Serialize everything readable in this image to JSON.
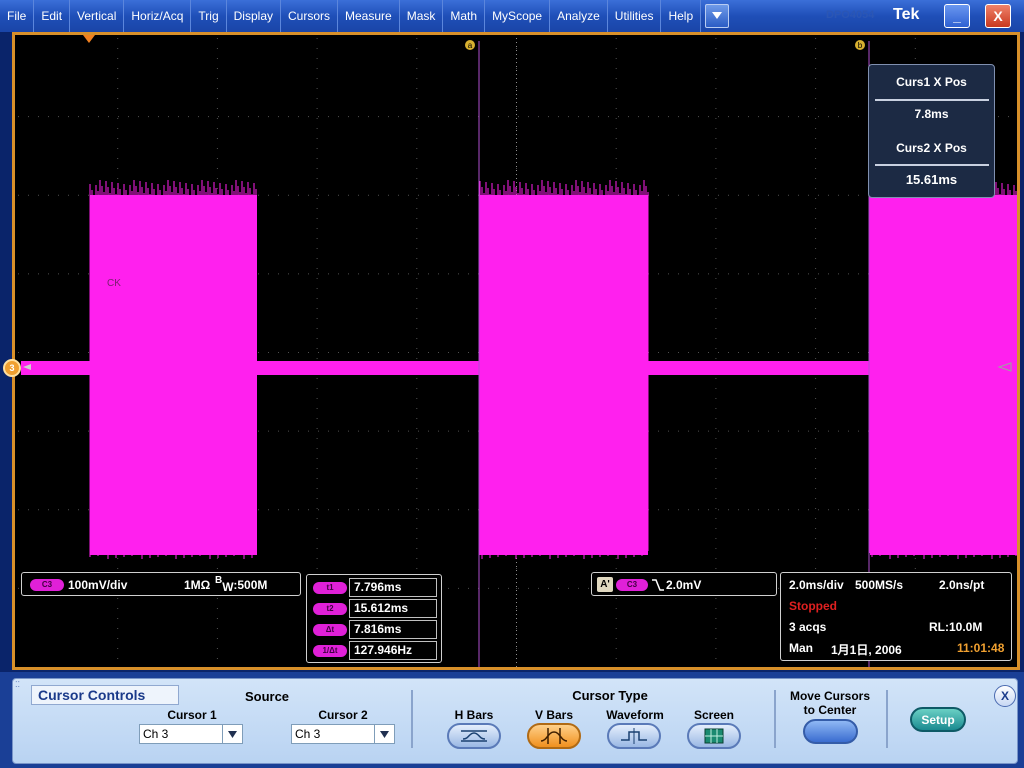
{
  "menu": {
    "items": [
      "File",
      "Edit",
      "Vertical",
      "Horiz/Acq",
      "Trig",
      "Display",
      "Cursors",
      "Measure",
      "Mask",
      "Math",
      "MyScope",
      "Analyze",
      "Utilities",
      "Help"
    ],
    "brand": "Tek",
    "ghost_text": "DPO4054"
  },
  "window": {
    "minimize": "_",
    "close": "X"
  },
  "markers": {
    "cursor1": "a",
    "cursor2": "b",
    "channel": "3",
    "trace_label": "CK"
  },
  "colors": {
    "trace": "#ff20ee",
    "frame": "#d8902a",
    "cursor_line": "#b050d0"
  },
  "channel_box": {
    "pill": "C3",
    "scale": "100mV/div",
    "impedance": "1MΩ",
    "bw_prefix": "B",
    "bw_sub": "W",
    "bw_value": ":500M"
  },
  "readouts": [
    {
      "pill": "t1",
      "value": "7.796ms"
    },
    {
      "pill": "t2",
      "value": "15.612ms"
    },
    {
      "pill": "Δt",
      "value": "7.816ms"
    },
    {
      "pill": "1/Δt",
      "value": "127.946Hz"
    }
  ],
  "trigger_box": {
    "source": "A'",
    "pill": "C3",
    "slope_icon": "falling-edge-icon",
    "level": "2.0mV"
  },
  "acq_box": {
    "timebase": "2.0ms/div",
    "sample_rate": "500MS/s",
    "resolution": "2.0ns/pt",
    "status": "Stopped",
    "acqs": "3 acqs",
    "record_length": "RL:10.0M",
    "mode": "Man",
    "date": "1月1日, 2006",
    "time": "11:01:48"
  },
  "cursor_positions": {
    "curs1_label": "Curs1 X Pos",
    "curs1_value": "7.8ms",
    "curs2_label": "Curs2 X Pos",
    "curs2_value": "15.61ms"
  },
  "controls": {
    "title": "Cursor Controls",
    "source_label": "Source",
    "cursor1_label": "Cursor 1",
    "cursor1_value": "Ch 3",
    "cursor2_label": "Cursor 2",
    "cursor2_value": "Ch 3",
    "cursor_type_label": "Cursor Type",
    "types": [
      {
        "label": "H Bars",
        "icon": "h-bars-icon"
      },
      {
        "label": "V Bars",
        "icon": "v-bars-icon",
        "active": true
      },
      {
        "label": "Waveform",
        "icon": "waveform-icon"
      },
      {
        "label": "Screen",
        "icon": "screen-icon"
      }
    ],
    "move_label_1": "Move Cursors",
    "move_label_2": "to Center",
    "setup_label": "Setup",
    "close_label": "X"
  }
}
